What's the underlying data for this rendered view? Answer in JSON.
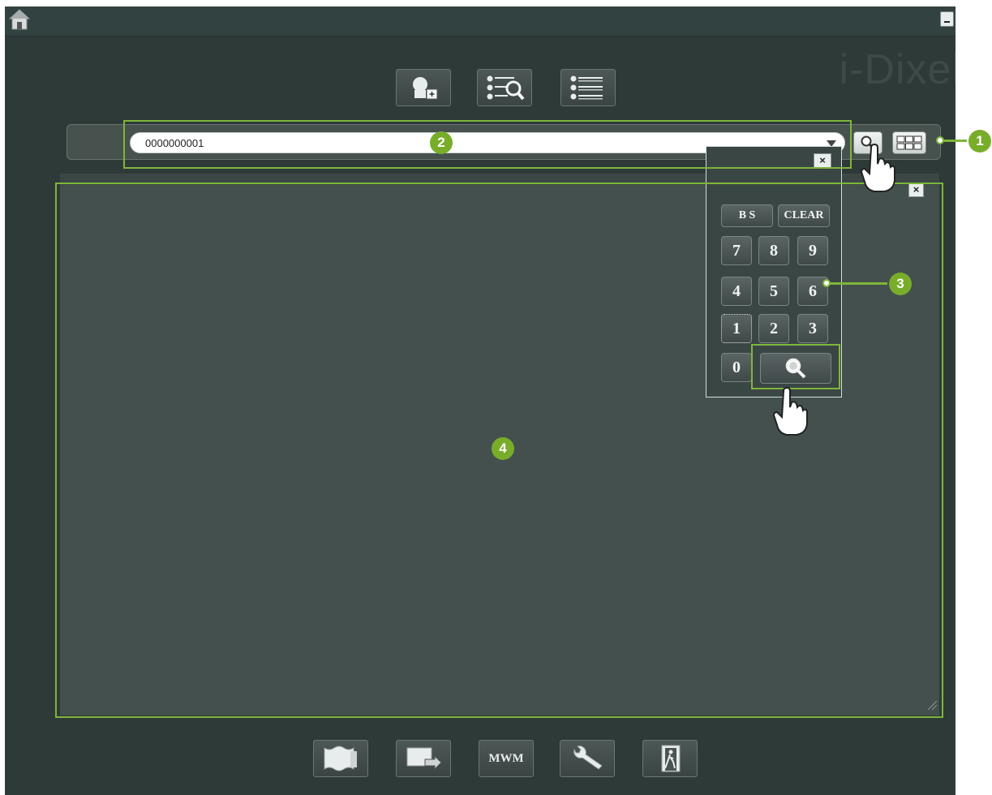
{
  "app": {
    "brand": "i-Dixel"
  },
  "search": {
    "patient_id": "0000000001"
  },
  "keypad": {
    "bs_label": "B S",
    "clear_label": "CLEAR",
    "close": "×",
    "keys": [
      "7",
      "8",
      "9",
      "4",
      "5",
      "6",
      "1",
      "2",
      "3",
      "0"
    ]
  },
  "panel": {
    "close": "×"
  },
  "bottom_toolbar": {
    "mwm_label": "MWM"
  },
  "callouts": [
    "1",
    "2",
    "3",
    "4"
  ],
  "icons": {
    "home": "home-icon",
    "new_patient": "add-patient-icon",
    "patient_search": "patient-search-icon",
    "patient_list": "patient-list-icon",
    "search": "magnifier-icon",
    "keypad_toggle": "numeric-keypad-icon",
    "gallery": "image-gallery-icon",
    "import": "import-image-icon",
    "settings": "wrench-icon",
    "exit": "exit-icon"
  },
  "colors": {
    "callout": "#78ad2a",
    "background": "#2e3a38",
    "panel": "#44504e"
  }
}
